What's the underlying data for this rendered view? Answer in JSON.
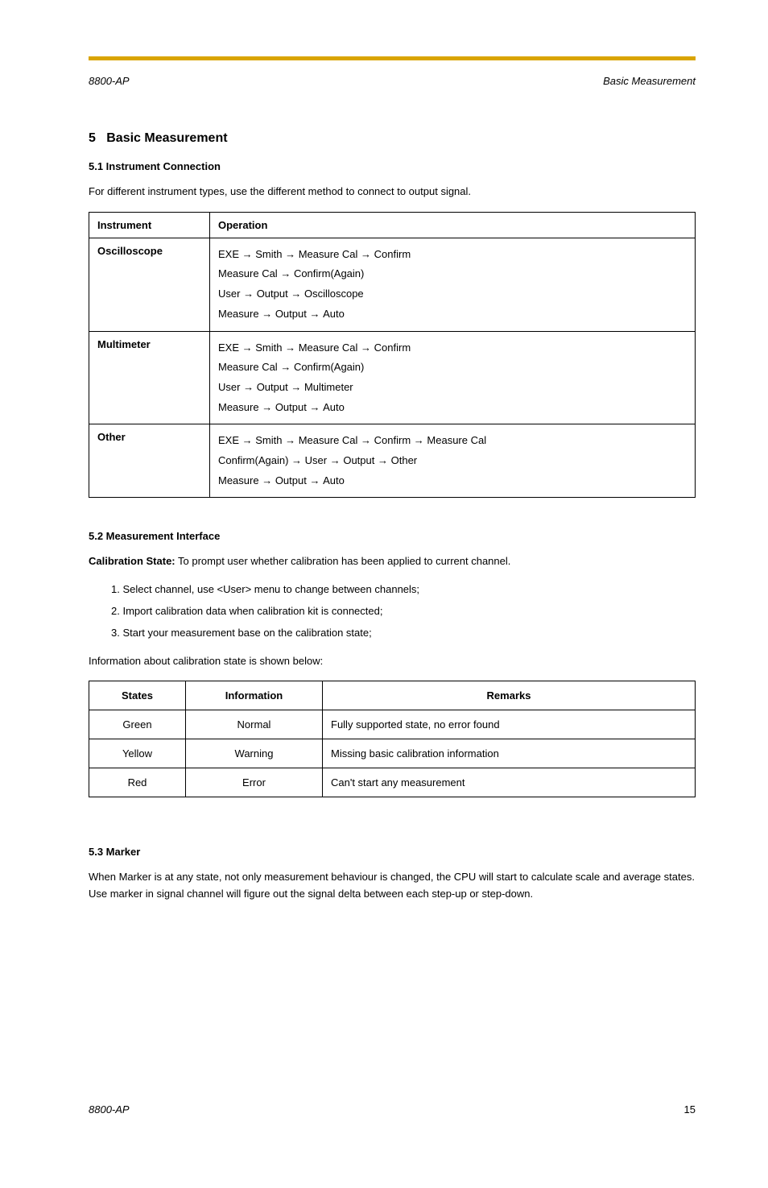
{
  "header": {
    "model": "8800-AP",
    "section": "Basic Measurement"
  },
  "chapter": {
    "number_label": "5",
    "title": "Basic Measurement"
  },
  "s51": {
    "heading": "5.1 Instrument Connection",
    "para": "For different instrument types, use the different method to connect to output signal."
  },
  "table1": {
    "headers": [
      "Instrument",
      "Operation"
    ],
    "rows": [
      {
        "instrument": "Oscilloscope",
        "steps": [
          [
            "EXE",
            "Smith",
            "Measure Cal",
            "Confirm"
          ],
          [
            "Measure Cal",
            "Confirm(Again)"
          ],
          [
            "User",
            "Output",
            "Oscilloscope"
          ],
          [
            "Measure",
            "Output",
            "Auto"
          ]
        ]
      },
      {
        "instrument": "Multimeter",
        "steps": [
          [
            "EXE",
            "Smith",
            "Measure Cal",
            "Confirm"
          ],
          [
            "Measure Cal",
            "Confirm(Again)"
          ],
          [
            "User",
            "Output",
            "Multimeter"
          ],
          [
            "Measure",
            "Output",
            "Auto"
          ]
        ]
      },
      {
        "instrument": "Other",
        "steps": [
          [
            "EXE",
            "Smith",
            "Measure Cal",
            "Confirm",
            "Measure Cal"
          ],
          [
            "Confirm(Again)",
            "User",
            "Output",
            "Other"
          ],
          [
            "Measure",
            "Output",
            "Auto"
          ]
        ]
      }
    ]
  },
  "s52": {
    "heading": "5.2 Measurement Interface",
    "intro_label": "Calibration State:",
    "intro_text": " To prompt user whether calibration has been applied to current channel.",
    "list": [
      "Select channel, use <User> menu to change between channels;",
      "Import calibration data when calibration kit is connected;",
      "Start your measurement base on the calibration state;"
    ],
    "para2": "Information about calibration state is shown below:"
  },
  "table2": {
    "headers": [
      "States",
      "Information",
      "Remarks"
    ],
    "rows": [
      {
        "state": "Green",
        "info": "Normal",
        "remarks": "Fully supported state, no error found"
      },
      {
        "state": "Yellow",
        "info": "Warning",
        "remarks": "Missing basic calibration information"
      },
      {
        "state": "Red",
        "info": "Error",
        "remarks": "Can't start any measurement"
      }
    ]
  },
  "s53": {
    "heading": "5.3 Marker",
    "para": "When Marker is at any state, not only measurement behaviour is changed, the CPU will start to calculate scale and average states. Use marker in signal channel will figure out the signal delta between each step-up or step-down."
  },
  "footer": {
    "model": "8800-AP",
    "page": "15"
  }
}
